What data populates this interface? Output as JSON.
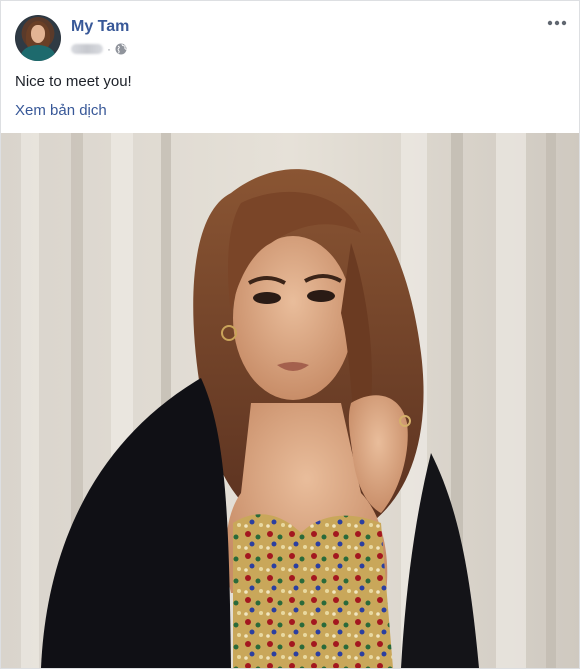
{
  "author": {
    "name": "My Tam",
    "avatar_icon": "avatar-image"
  },
  "meta": {
    "audience_icon": "globe-icon",
    "separator": "·"
  },
  "menu": {
    "icon": "more-options-icon"
  },
  "post": {
    "text": "Nice to meet you!",
    "translate_label": "Xem bản dịch"
  },
  "colors": {
    "link": "#385898",
    "text": "#1d2129",
    "muted": "#90949c",
    "border": "#dddfe2"
  },
  "photo": {
    "description_icon": "post-photo"
  }
}
